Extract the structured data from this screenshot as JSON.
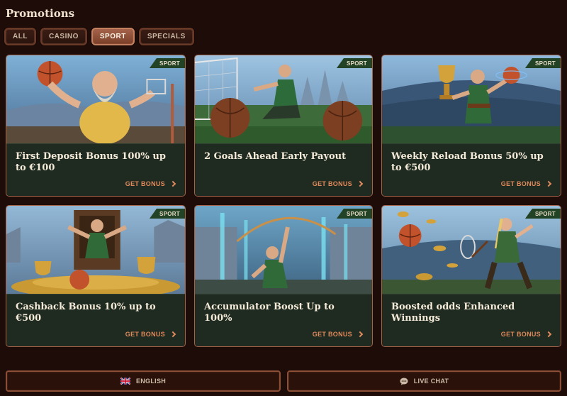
{
  "page": {
    "title": "Promotions"
  },
  "filters": [
    {
      "label": "ALL",
      "active": false
    },
    {
      "label": "CASINO",
      "active": false
    },
    {
      "label": "SPORT",
      "active": true
    },
    {
      "label": "SPECIALS",
      "active": false
    }
  ],
  "promotions": [
    {
      "badge": "SPORT",
      "title": "First Deposit Bonus 100% up to €100",
      "cta": "GET BONUS",
      "image": "basketball-player-illustration"
    },
    {
      "badge": "SPORT",
      "title": "2 Goals Ahead Early Payout",
      "cta": "GET BONUS",
      "image": "football-player-illustration"
    },
    {
      "badge": "SPORT",
      "title": "Weekly Reload Bonus 50% up to €500",
      "cta": "GET BONUS",
      "image": "trophy-hero-illustration"
    },
    {
      "badge": "SPORT",
      "title": "Cashback Bonus 10% up to €500",
      "cta": "GET BONUS",
      "image": "throne-king-illustration"
    },
    {
      "badge": "SPORT",
      "title": "Accumulator Boost Up to 100%",
      "cta": "GET BONUS",
      "image": "archer-illustration"
    },
    {
      "badge": "SPORT",
      "title": "Boosted odds Enhanced Winnings",
      "cta": "GET BONUS",
      "image": "tennis-heroine-illustration"
    }
  ],
  "footer": {
    "language_label": "ENGLISH",
    "language_icon": "uk-flag-icon",
    "chat_label": "LIVE CHAT",
    "chat_icon": "chat-bubble-icon"
  },
  "colors": {
    "background": "#1d0c07",
    "card_border": "#a5634a",
    "card_body": "#1f2a21",
    "badge": "#234327",
    "accent": "#e08a5b"
  }
}
